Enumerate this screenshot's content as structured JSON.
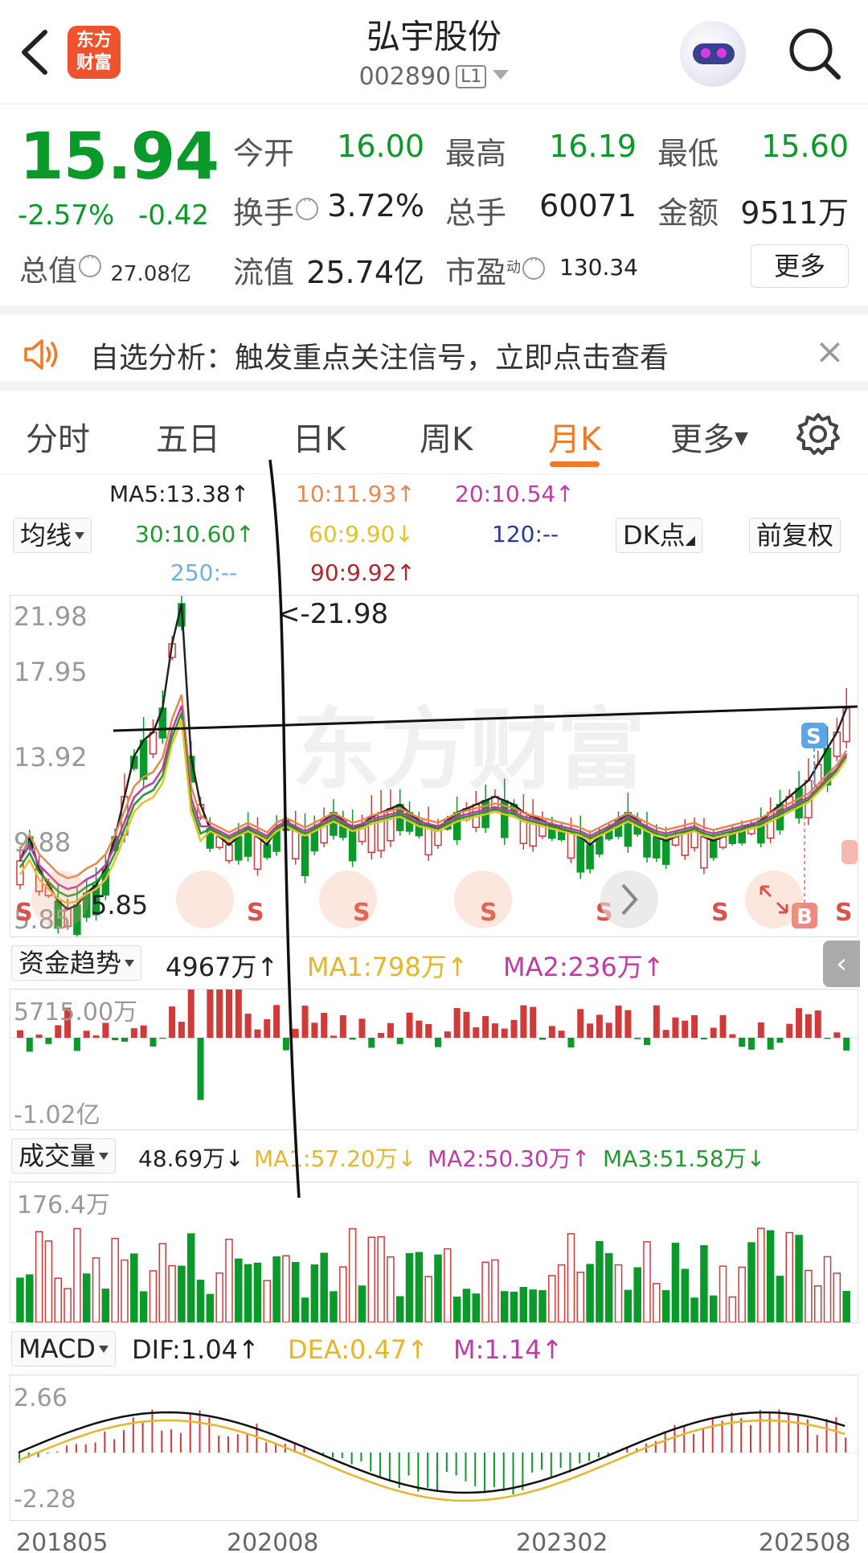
{
  "header": {
    "title": "弘宇股份",
    "code": "002890",
    "level_badge": "L1",
    "logo_line1": "东方",
    "logo_line2": "财富"
  },
  "quote": {
    "price": "15.94",
    "change_pct": "-2.57%",
    "change": "-0.42",
    "total_cap_label": "总值",
    "total_cap_value": "27.08亿",
    "open_label": "今开",
    "open": "16.00",
    "high_label": "最高",
    "high": "16.19",
    "low_label": "最低",
    "low": "15.60",
    "turnover_label": "换手",
    "turnover": "3.72%",
    "volume_label": "总手",
    "volume": "60071",
    "amount_label": "金额",
    "amount": "9511万",
    "float_cap_label": "流值",
    "float_cap": "25.74亿",
    "pe_label": "市盈",
    "pe_sup": "动",
    "pe": "130.34",
    "more_label": "更多"
  },
  "banner": {
    "text": "自选分析：触发重点关注信号，立即点击查看"
  },
  "tabs": [
    "分时",
    "五日",
    "日K",
    "周K",
    "月K",
    "更多"
  ],
  "active_tab": "月K",
  "ma": {
    "selector": "均线",
    "ma5": "MA5:13.38↑",
    "ma10": "10:11.93↑",
    "ma20": "20:10.54↑",
    "ma30": "30:10.60↑",
    "ma60": "60:9.90↓",
    "ma120": "120:--",
    "ma250": "250:--",
    "ma90": "90:9.92↑",
    "dk_button": "DK点",
    "adjust_button": "前复权"
  },
  "colors": {
    "up": "#d23a3a",
    "down": "#0a9a2a",
    "accent": "#f27a26",
    "ma5": "#222222",
    "ma10": "#e8874e",
    "ma20": "#c23aa6",
    "ma30": "#1f9a2f",
    "ma60": "#e7c02a",
    "ma120": "#2a3a9a",
    "ma250": "#6ab0e0",
    "ma90": "#b0262a"
  },
  "kline": {
    "y_ticks": [
      "21.98",
      "17.95",
      "13.92",
      "9.88",
      "5.85"
    ],
    "high_marker": "<-21.98",
    "low_marker": "5.85",
    "watermark": "东方财富",
    "signal_s": "S",
    "signal_b": "B"
  },
  "fund_flow": {
    "selector": "资金趋势",
    "value": "4967万↑",
    "ma1": "MA1:798万↑",
    "ma2": "MA2:236万↑",
    "top": "5715.00万",
    "bottom": "-1.02亿"
  },
  "volume": {
    "selector": "成交量",
    "value": "48.69万↓",
    "ma1": "MA1:57.20万↓",
    "ma2": "MA2:50.30万↑",
    "ma3": "MA3:51.58万↓",
    "top": "176.4万"
  },
  "macd": {
    "selector": "MACD",
    "dif": "DIF:1.04↑",
    "dea": "DEA:0.47↑",
    "m": "M:1.14↑",
    "top": "2.66",
    "bottom": "-2.28"
  },
  "x_axis": [
    "201805",
    "202008",
    "202302",
    "202508"
  ]
}
